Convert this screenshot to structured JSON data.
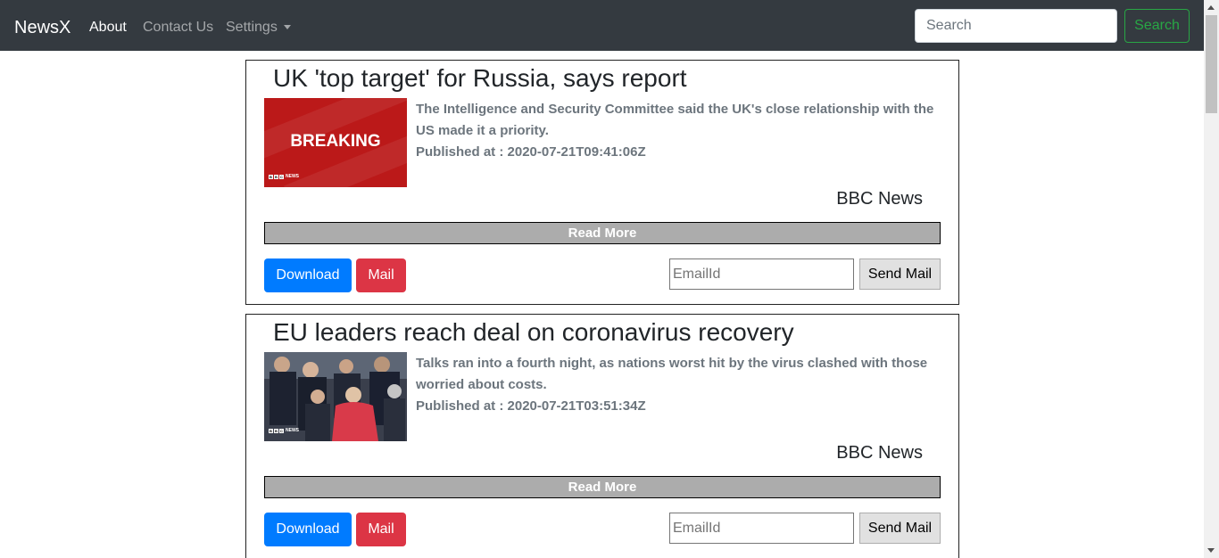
{
  "navbar": {
    "brand": "NewsX",
    "links": [
      "About",
      "Contact Us",
      "Settings"
    ],
    "search_placeholder": "Search",
    "search_button": "Search"
  },
  "articles": [
    {
      "title": "UK 'top target' for Russia, says report",
      "image_text": "BREAKING",
      "image_logo": "NEWS",
      "description": "The Intelligence and Security Committee said the UK's close relationship with the US made it a priority.",
      "published": "Published at : 2020-07-21T09:41:06Z",
      "source": "BBC News",
      "read_more": "Read More",
      "download": "Download",
      "mail": "Mail",
      "email_placeholder": "EmailId",
      "send_mail": "Send Mail"
    },
    {
      "title": "EU leaders reach deal on coronavirus recovery",
      "image_logo": "NEWS",
      "description": "Talks ran into a fourth night, as nations worst hit by the virus clashed with those worried about costs.",
      "published": "Published at : 2020-07-21T03:51:34Z",
      "source": "BBC News",
      "read_more": "Read More",
      "download": "Download",
      "mail": "Mail",
      "email_placeholder": "EmailId",
      "send_mail": "Send Mail"
    }
  ],
  "colors": {
    "navbar_bg": "#343a40",
    "search_green": "#28a745",
    "download_blue": "#007bff",
    "mail_red": "#dc3545",
    "breaking_red": "#bb1919"
  }
}
